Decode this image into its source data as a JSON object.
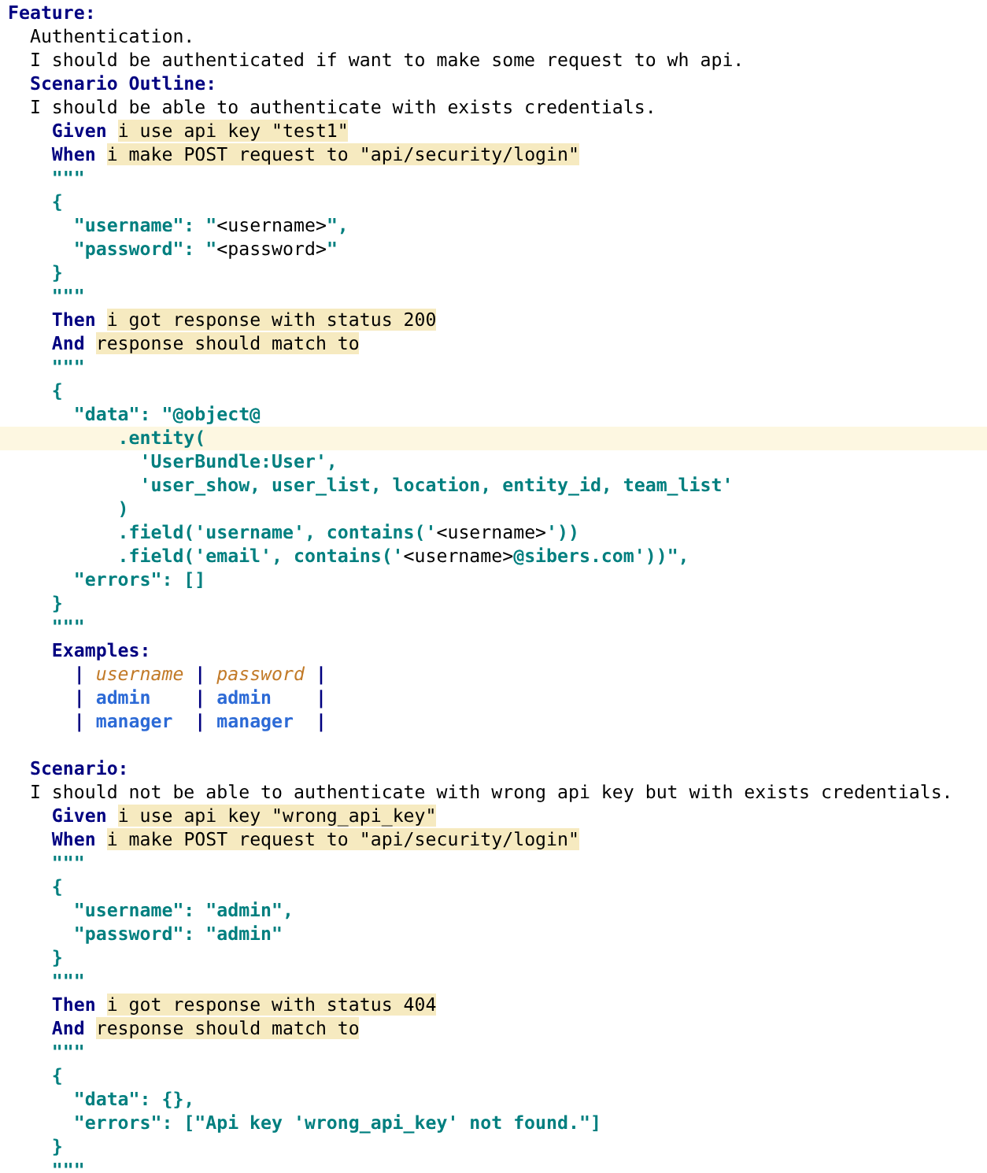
{
  "editor": {
    "lines": [
      {
        "kind": "code",
        "current": false,
        "tokens": [
          {
            "kind": "keyword",
            "text": "Feature:"
          }
        ]
      },
      {
        "kind": "code",
        "current": false,
        "tokens": [
          {
            "kind": "plain",
            "text": "  Authentication."
          }
        ]
      },
      {
        "kind": "code",
        "current": false,
        "tokens": [
          {
            "kind": "plain",
            "text": "  I should be authenticated if want to make some request to wh api."
          }
        ]
      },
      {
        "kind": "code",
        "current": false,
        "tokens": [
          {
            "kind": "keyword",
            "text": "  Scenario Outline:"
          }
        ]
      },
      {
        "kind": "code",
        "current": false,
        "tokens": [
          {
            "kind": "plain",
            "text": "  I should be able to authenticate with exists credentials."
          }
        ]
      },
      {
        "kind": "code",
        "current": false,
        "tokens": [
          {
            "kind": "keyword",
            "text": "    Given "
          },
          {
            "kind": "step",
            "text": "i use api key \"test1\""
          }
        ]
      },
      {
        "kind": "code",
        "current": false,
        "tokens": [
          {
            "kind": "keyword",
            "text": "    When "
          },
          {
            "kind": "step",
            "text": "i make POST request to \"api/security/login\""
          }
        ]
      },
      {
        "kind": "code",
        "current": false,
        "tokens": [
          {
            "kind": "string",
            "text": "    \"\"\""
          }
        ]
      },
      {
        "kind": "code",
        "current": false,
        "tokens": [
          {
            "kind": "string",
            "text": "    {"
          }
        ]
      },
      {
        "kind": "code",
        "current": false,
        "tokens": [
          {
            "kind": "string",
            "text": "      \"username\": \""
          },
          {
            "kind": "placeholder",
            "text": "<username>"
          },
          {
            "kind": "string",
            "text": "\","
          }
        ]
      },
      {
        "kind": "code",
        "current": false,
        "tokens": [
          {
            "kind": "string",
            "text": "      \"password\": \""
          },
          {
            "kind": "placeholder",
            "text": "<password>"
          },
          {
            "kind": "string",
            "text": "\""
          }
        ]
      },
      {
        "kind": "code",
        "current": false,
        "tokens": [
          {
            "kind": "string",
            "text": "    }"
          }
        ]
      },
      {
        "kind": "code",
        "current": false,
        "tokens": [
          {
            "kind": "string",
            "text": "    \"\"\""
          }
        ]
      },
      {
        "kind": "code",
        "current": false,
        "tokens": [
          {
            "kind": "keyword",
            "text": "    Then "
          },
          {
            "kind": "step",
            "text": "i got response with status 200"
          }
        ]
      },
      {
        "kind": "code",
        "current": false,
        "tokens": [
          {
            "kind": "keyword",
            "text": "    And "
          },
          {
            "kind": "step",
            "text": "response should match to"
          }
        ]
      },
      {
        "kind": "code",
        "current": false,
        "tokens": [
          {
            "kind": "string",
            "text": "    \"\"\""
          }
        ]
      },
      {
        "kind": "code",
        "current": false,
        "tokens": [
          {
            "kind": "string",
            "text": "    {"
          }
        ]
      },
      {
        "kind": "code",
        "current": false,
        "tokens": [
          {
            "kind": "string",
            "text": "      \"data\": \"@object@"
          }
        ]
      },
      {
        "kind": "code",
        "current": true,
        "tokens": [
          {
            "kind": "string",
            "text": "          .entity("
          }
        ]
      },
      {
        "kind": "code",
        "current": false,
        "tokens": [
          {
            "kind": "string",
            "text": "            'UserBundle:User',"
          }
        ]
      },
      {
        "kind": "code",
        "current": false,
        "tokens": [
          {
            "kind": "string",
            "text": "            'user_show, user_list, location, entity_id, team_list'"
          }
        ]
      },
      {
        "kind": "code",
        "current": false,
        "tokens": [
          {
            "kind": "string",
            "text": "          )"
          }
        ]
      },
      {
        "kind": "code",
        "current": false,
        "tokens": [
          {
            "kind": "string",
            "text": "          .field('username', contains('"
          },
          {
            "kind": "placeholder",
            "text": "<username>"
          },
          {
            "kind": "string",
            "text": "'))"
          }
        ]
      },
      {
        "kind": "code",
        "current": false,
        "tokens": [
          {
            "kind": "string",
            "text": "          .field('email', contains('"
          },
          {
            "kind": "placeholder",
            "text": "<username>"
          },
          {
            "kind": "string",
            "text": "@sibers.com'))\","
          }
        ]
      },
      {
        "kind": "code",
        "current": false,
        "tokens": [
          {
            "kind": "string",
            "text": "      \"errors\": []"
          }
        ]
      },
      {
        "kind": "code",
        "current": false,
        "tokens": [
          {
            "kind": "string",
            "text": "    }"
          }
        ]
      },
      {
        "kind": "code",
        "current": false,
        "tokens": [
          {
            "kind": "string",
            "text": "    \"\"\""
          }
        ]
      },
      {
        "kind": "code",
        "current": false,
        "tokens": [
          {
            "kind": "keyword",
            "text": "    Examples:"
          }
        ]
      },
      {
        "kind": "code",
        "current": false,
        "tokens": [
          {
            "kind": "pipe",
            "text": "      | "
          },
          {
            "kind": "header",
            "text": "username"
          },
          {
            "kind": "pipe",
            "text": " | "
          },
          {
            "kind": "header",
            "text": "password"
          },
          {
            "kind": "pipe",
            "text": " |"
          }
        ]
      },
      {
        "kind": "code",
        "current": false,
        "tokens": [
          {
            "kind": "pipe",
            "text": "      | "
          },
          {
            "kind": "cell",
            "text": "admin"
          },
          {
            "kind": "pipe",
            "text": "    | "
          },
          {
            "kind": "cell",
            "text": "admin"
          },
          {
            "kind": "pipe",
            "text": "    |"
          }
        ]
      },
      {
        "kind": "code",
        "current": false,
        "tokens": [
          {
            "kind": "pipe",
            "text": "      | "
          },
          {
            "kind": "cell",
            "text": "manager"
          },
          {
            "kind": "pipe",
            "text": "  | "
          },
          {
            "kind": "cell",
            "text": "manager"
          },
          {
            "kind": "pipe",
            "text": "  |"
          }
        ]
      },
      {
        "kind": "blank",
        "current": false
      },
      {
        "kind": "code",
        "current": false,
        "tokens": [
          {
            "kind": "keyword",
            "text": "  Scenario:"
          }
        ]
      },
      {
        "kind": "code",
        "current": false,
        "tokens": [
          {
            "kind": "plain",
            "text": "  I should not be able to authenticate with wrong api key but with exists credentials."
          }
        ]
      },
      {
        "kind": "code",
        "current": false,
        "tokens": [
          {
            "kind": "keyword",
            "text": "    Given "
          },
          {
            "kind": "step",
            "text": "i use api key \"wrong_api_key\""
          }
        ]
      },
      {
        "kind": "code",
        "current": false,
        "tokens": [
          {
            "kind": "keyword",
            "text": "    When "
          },
          {
            "kind": "step",
            "text": "i make POST request to \"api/security/login\""
          }
        ]
      },
      {
        "kind": "code",
        "current": false,
        "tokens": [
          {
            "kind": "string",
            "text": "    \"\"\""
          }
        ]
      },
      {
        "kind": "code",
        "current": false,
        "tokens": [
          {
            "kind": "string",
            "text": "    {"
          }
        ]
      },
      {
        "kind": "code",
        "current": false,
        "tokens": [
          {
            "kind": "string",
            "text": "      \"username\": \"admin\","
          }
        ]
      },
      {
        "kind": "code",
        "current": false,
        "tokens": [
          {
            "kind": "string",
            "text": "      \"password\": \"admin\""
          }
        ]
      },
      {
        "kind": "code",
        "current": false,
        "tokens": [
          {
            "kind": "string",
            "text": "    }"
          }
        ]
      },
      {
        "kind": "code",
        "current": false,
        "tokens": [
          {
            "kind": "string",
            "text": "    \"\"\""
          }
        ]
      },
      {
        "kind": "code",
        "current": false,
        "tokens": [
          {
            "kind": "keyword",
            "text": "    Then "
          },
          {
            "kind": "step",
            "text": "i got response with status 404"
          }
        ]
      },
      {
        "kind": "code",
        "current": false,
        "tokens": [
          {
            "kind": "keyword",
            "text": "    And "
          },
          {
            "kind": "step",
            "text": "response should match to"
          }
        ]
      },
      {
        "kind": "code",
        "current": false,
        "tokens": [
          {
            "kind": "string",
            "text": "    \"\"\""
          }
        ]
      },
      {
        "kind": "code",
        "current": false,
        "tokens": [
          {
            "kind": "string",
            "text": "    {"
          }
        ]
      },
      {
        "kind": "code",
        "current": false,
        "tokens": [
          {
            "kind": "string",
            "text": "      \"data\": {},"
          }
        ]
      },
      {
        "kind": "code",
        "current": false,
        "tokens": [
          {
            "kind": "string",
            "text": "      \"errors\": [\"Api key 'wrong_api_key' not found.\"]"
          }
        ]
      },
      {
        "kind": "code",
        "current": false,
        "tokens": [
          {
            "kind": "string",
            "text": "    }"
          }
        ]
      },
      {
        "kind": "code",
        "current": false,
        "tokens": [
          {
            "kind": "string",
            "text": "    \"\"\""
          }
        ]
      }
    ]
  }
}
